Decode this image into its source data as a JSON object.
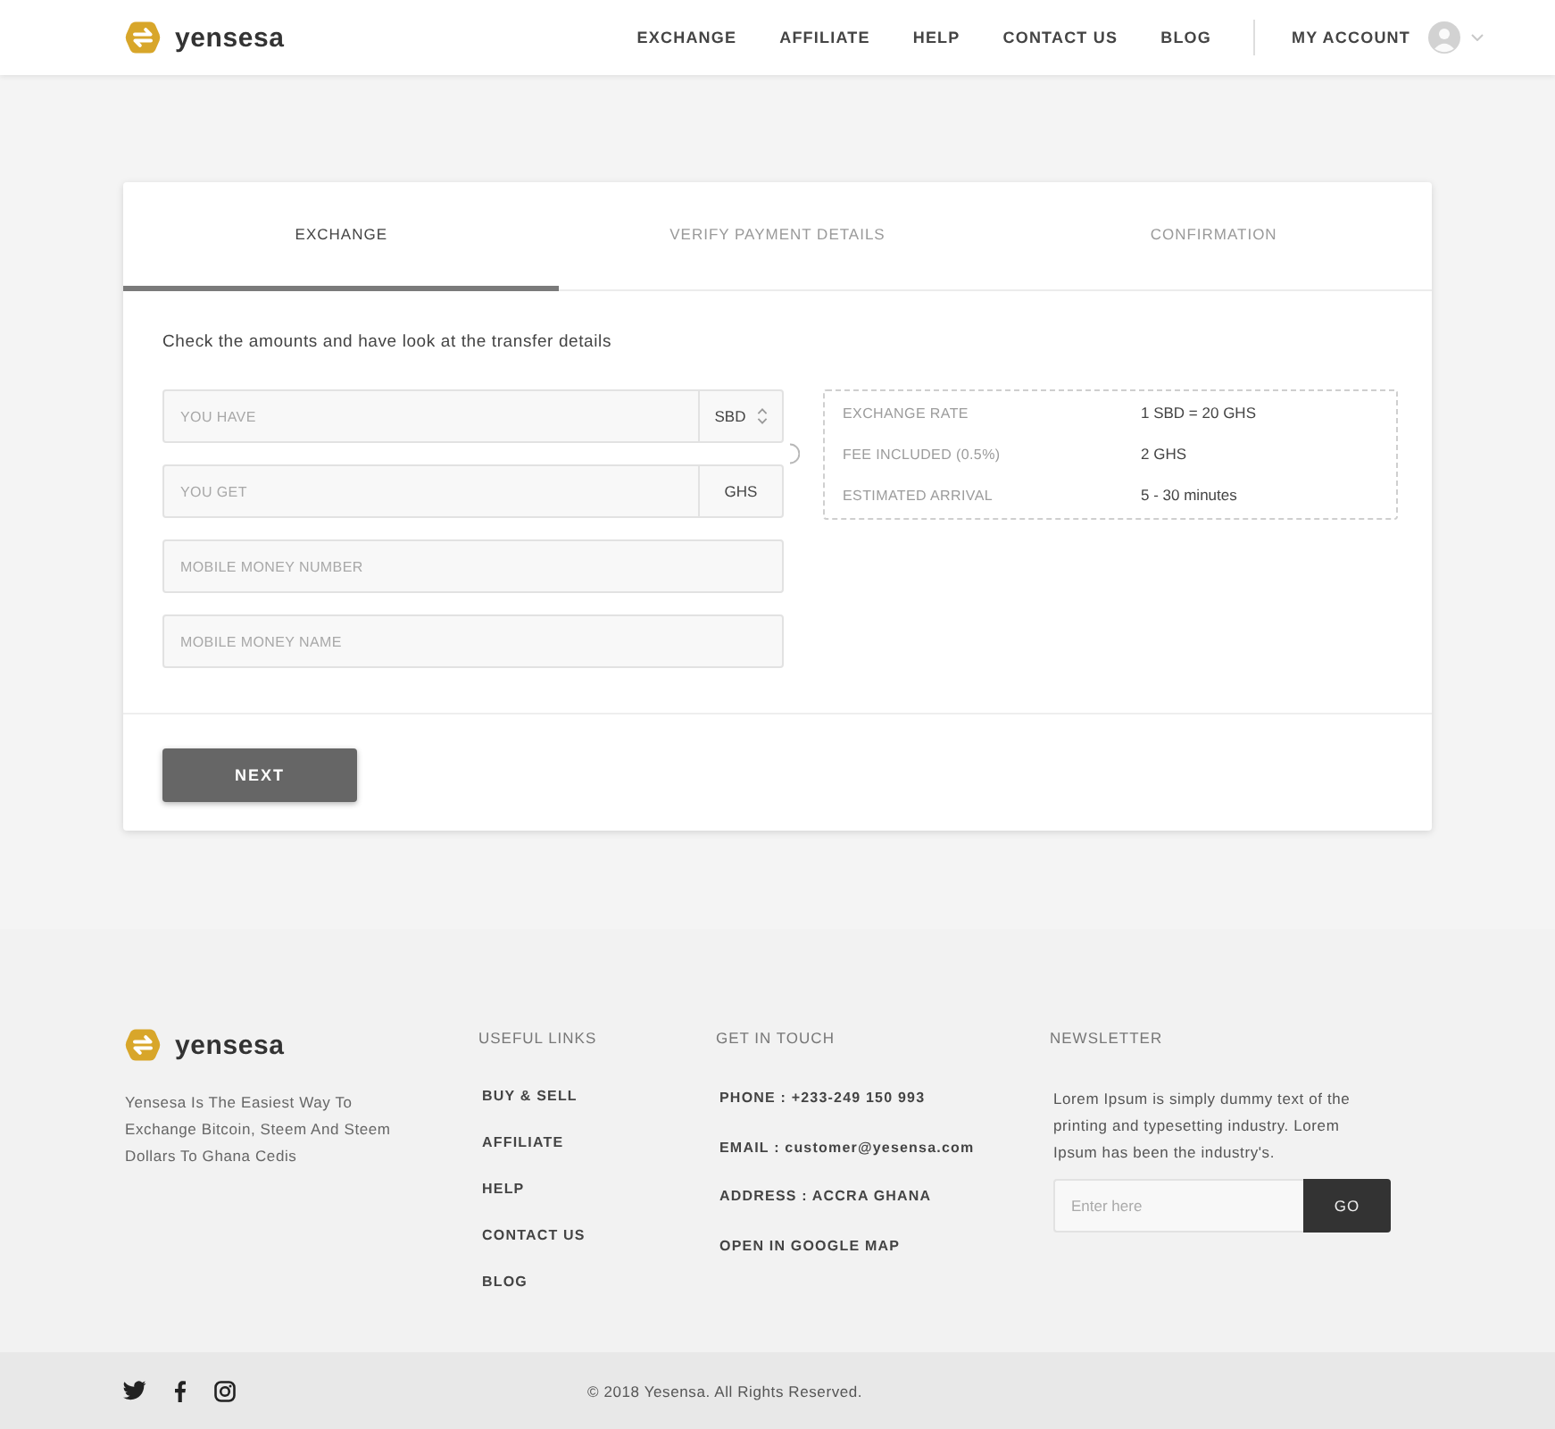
{
  "header": {
    "logo_text": "yensesa",
    "nav": [
      "EXCHANGE",
      "AFFILIATE",
      "HELP",
      "CONTACT US",
      "BLOG"
    ],
    "account": "MY ACCOUNT"
  },
  "steps": [
    {
      "label": "EXCHANGE",
      "selected": true
    },
    {
      "label": "VERIFY PAYMENT DETAILS",
      "selected": false
    },
    {
      "label": "CONFIRMATION",
      "selected": false
    }
  ],
  "form": {
    "instruction": "Check the amounts and have look at the transfer details",
    "fields": [
      {
        "kind": "select",
        "placeholder": "YOU HAVE",
        "currency": "SBD"
      },
      {
        "kind": "unit",
        "placeholder": "YOU GET",
        "currency": "GHS"
      },
      {
        "kind": "text",
        "placeholder": "MOBILE MONEY NUMBER"
      },
      {
        "kind": "text",
        "placeholder": "MOBILE MONEY NAME"
      }
    ],
    "details": [
      {
        "label": "EXCHANGE RATE",
        "value": "1 SBD = 20 GHS"
      },
      {
        "label": "FEE INCLUDED (0.5%)",
        "value": "2 GHS"
      },
      {
        "label": "ESTIMATED ARRIVAL",
        "value": "5 - 30 minutes"
      }
    ],
    "button": "NEXT"
  },
  "footer": {
    "brand": {
      "logo_text": "yensesa",
      "description": "Yensesa Is The Easiest Way To Exchange Bitcoin, Steem And Steem Dollars To Ghana Cedis"
    },
    "useful_links": {
      "title": "USEFUL LINKS",
      "items": [
        "BUY & SELL",
        "AFFILIATE",
        "HELP",
        "CONTACT US",
        "BLOG"
      ]
    },
    "get_in_touch": {
      "title": "GET IN TOUCH",
      "items": [
        "PHONE : +233-249 150 993",
        "EMAIL : customer@yesensa.com",
        "ADDRESS : ACCRA GHANA",
        "OPEN IN GOOGLE MAP"
      ]
    },
    "newsletter": {
      "title": "NEWSLETTER",
      "text": "Lorem Ipsum is simply dummy text of the printing and typesetting industry. Lorem Ipsum has been the industry's.",
      "placeholder": "Enter here",
      "button": "GO"
    }
  },
  "bottom_bar": {
    "copyright": "© 2018 Yesensa. All Rights Reserved."
  }
}
